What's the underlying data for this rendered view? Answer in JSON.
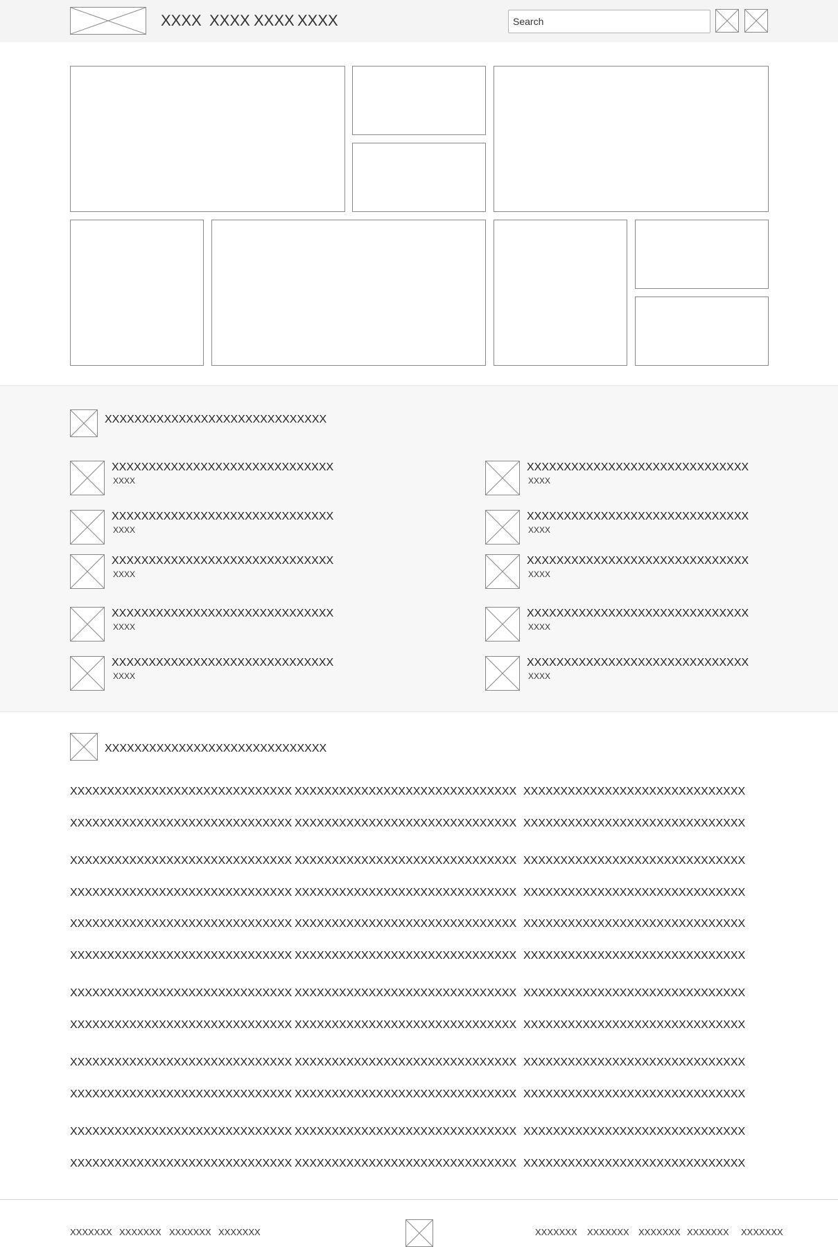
{
  "header": {
    "nav": [
      "XXXX",
      "XXXX",
      "XXXX",
      "XXXX"
    ],
    "search_placeholder": "Search",
    "logo_icon": "image-placeholder-icon",
    "action_icons": [
      "image-placeholder-icon",
      "image-placeholder-icon"
    ]
  },
  "featured": {
    "section_heading": "XXXXXXXXXXXXXXXXXXXXXXXXXXXXXX",
    "items": [
      {
        "title": "XXXXXXXXXXXXXXXXXXXXXXXXXXXXXX",
        "meta": "XXXX"
      },
      {
        "title": "XXXXXXXXXXXXXXXXXXXXXXXXXXXXXX",
        "meta": "XXXX"
      },
      {
        "title": "XXXXXXXXXXXXXXXXXXXXXXXXXXXXXX",
        "meta": "XXXX"
      },
      {
        "title": "XXXXXXXXXXXXXXXXXXXXXXXXXXXXXX",
        "meta": "XXXX"
      },
      {
        "title": "XXXXXXXXXXXXXXXXXXXXXXXXXXXXXX",
        "meta": "XXXX"
      },
      {
        "title": "XXXXXXXXXXXXXXXXXXXXXXXXXXXXXX",
        "meta": "XXXX"
      },
      {
        "title": "XXXXXXXXXXXXXXXXXXXXXXXXXXXXXX",
        "meta": "XXXX"
      },
      {
        "title": "XXXXXXXXXXXXXXXXXXXXXXXXXXXXXX",
        "meta": "XXXX"
      },
      {
        "title": "XXXXXXXXXXXXXXXXXXXXXXXXXXXXXX",
        "meta": "XXXX"
      },
      {
        "title": "XXXXXXXXXXXXXXXXXXXXXXXXXXXXXX",
        "meta": "XXXX"
      }
    ]
  },
  "directory": {
    "section_heading": "XXXXXXXXXXXXXXXXXXXXXXXXXXXXXX",
    "links": [
      "XXXXXXXXXXXXXXXXXXXXXXXXXXXXXX",
      "XXXXXXXXXXXXXXXXXXXXXXXXXXXXXX",
      "XXXXXXXXXXXXXXXXXXXXXXXXXXXXXX",
      "XXXXXXXXXXXXXXXXXXXXXXXXXXXXXX",
      "XXXXXXXXXXXXXXXXXXXXXXXXXXXXXX",
      "XXXXXXXXXXXXXXXXXXXXXXXXXXXXXX",
      "XXXXXXXXXXXXXXXXXXXXXXXXXXXXXX",
      "XXXXXXXXXXXXXXXXXXXXXXXXXXXXXX",
      "XXXXXXXXXXXXXXXXXXXXXXXXXXXXXX",
      "XXXXXXXXXXXXXXXXXXXXXXXXXXXXXX",
      "XXXXXXXXXXXXXXXXXXXXXXXXXXXXXX",
      "XXXXXXXXXXXXXXXXXXXXXXXXXXXXXX",
      "XXXXXXXXXXXXXXXXXXXXXXXXXXXXXX",
      "XXXXXXXXXXXXXXXXXXXXXXXXXXXXXX",
      "XXXXXXXXXXXXXXXXXXXXXXXXXXXXXX",
      "XXXXXXXXXXXXXXXXXXXXXXXXXXXXXX",
      "XXXXXXXXXXXXXXXXXXXXXXXXXXXXXX",
      "XXXXXXXXXXXXXXXXXXXXXXXXXXXXXX",
      "XXXXXXXXXXXXXXXXXXXXXXXXXXXXXX",
      "XXXXXXXXXXXXXXXXXXXXXXXXXXXXXX",
      "XXXXXXXXXXXXXXXXXXXXXXXXXXXXXX",
      "XXXXXXXXXXXXXXXXXXXXXXXXXXXXXX",
      "XXXXXXXXXXXXXXXXXXXXXXXXXXXXXX",
      "XXXXXXXXXXXXXXXXXXXXXXXXXXXXXX",
      "XXXXXXXXXXXXXXXXXXXXXXXXXXXXXX",
      "XXXXXXXXXXXXXXXXXXXXXXXXXXXXXX",
      "XXXXXXXXXXXXXXXXXXXXXXXXXXXXXX",
      "XXXXXXXXXXXXXXXXXXXXXXXXXXXXXX",
      "XXXXXXXXXXXXXXXXXXXXXXXXXXXXXX",
      "XXXXXXXXXXXXXXXXXXXXXXXXXXXXXX",
      "XXXXXXXXXXXXXXXXXXXXXXXXXXXXXX",
      "XXXXXXXXXXXXXXXXXXXXXXXXXXXXXX",
      "XXXXXXXXXXXXXXXXXXXXXXXXXXXXXX",
      "XXXXXXXXXXXXXXXXXXXXXXXXXXXXXX",
      "XXXXXXXXXXXXXXXXXXXXXXXXXXXXXX",
      "XXXXXXXXXXXXXXXXXXXXXXXXXXXXXX"
    ]
  },
  "footer": {
    "left_links": [
      "XXXXXXX",
      "XXXXXXX",
      "XXXXXXX",
      "XXXXXXX"
    ],
    "right_links": [
      "XXXXXXX",
      "XXXXXXX",
      "XXXXXXX",
      "XXXXXXX",
      "XXXXXXX"
    ],
    "logo_icon": "image-placeholder-icon"
  }
}
